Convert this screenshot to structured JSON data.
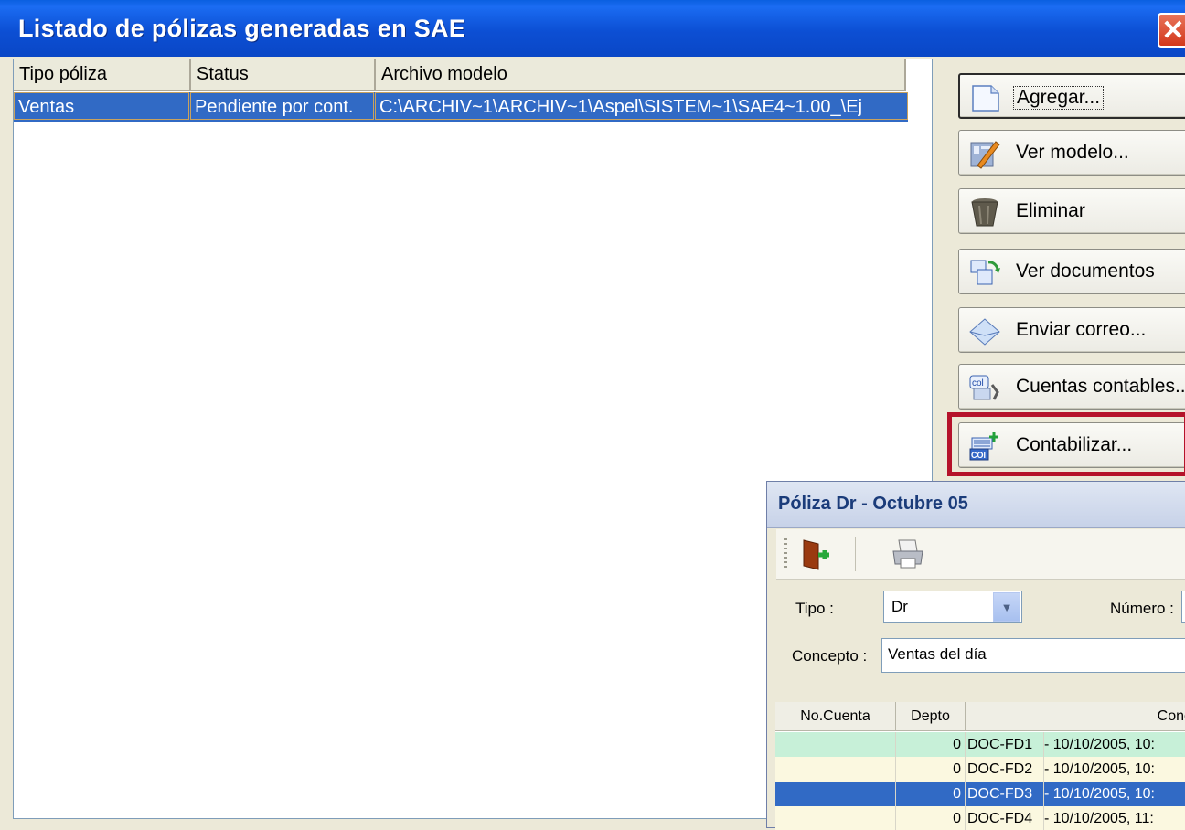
{
  "window": {
    "title": "Listado de pólizas generadas en SAE",
    "close_glyph": "✕"
  },
  "list": {
    "columns": [
      "Tipo póliza",
      "Status",
      "Archivo modelo"
    ],
    "rows": [
      {
        "tipo": "Ventas",
        "status": "Pendiente por cont.",
        "archivo": "C:\\ARCHIV~1\\ARCHIV~1\\Aspel\\SISTEM~1\\SAE4~1.00_\\Ej"
      }
    ]
  },
  "buttons": {
    "agregar": "Agregar...",
    "ver_modelo": "Ver modelo...",
    "eliminar": "Eliminar",
    "ver_documentos": "Ver documentos",
    "enviar_correo": "Enviar correo...",
    "cuentas_contables": "Cuentas contables...",
    "contabilizar": "Contabilizar..."
  },
  "icons": [
    "document-icon",
    "model-pencil-icon",
    "trash-icon",
    "documents-icon",
    "envelope-icon",
    "accounts-icon",
    "post-icon",
    "exit-door-icon",
    "printer-icon"
  ],
  "colors": {
    "titlebar": "#0a47c6",
    "selection": "#316ac5",
    "highlight_box": "#b5122a",
    "row_green": "#c7f0d8",
    "row_cream": "#fbf8e0"
  },
  "poliza": {
    "title": "Póliza Dr  - Octubre 05",
    "tipo_label": "Tipo :",
    "tipo_value": "Dr",
    "numero_label": "Número :",
    "concepto_label": "Concepto :",
    "concepto_value": "Ventas del día",
    "grid_headers": [
      "No.Cuenta",
      "Depto",
      "Conc"
    ],
    "grid_rows": [
      {
        "depto": "0",
        "doc": "DOC-FD1",
        "concepto": "- 10/10/2005, 10:"
      },
      {
        "depto": "0",
        "doc": "DOC-FD2",
        "concepto": "- 10/10/2005, 10:"
      },
      {
        "depto": "0",
        "doc": "DOC-FD3",
        "concepto": "- 10/10/2005, 10:"
      },
      {
        "depto": "0",
        "doc": "DOC-FD4",
        "concepto": "- 10/10/2005, 11:"
      }
    ]
  }
}
